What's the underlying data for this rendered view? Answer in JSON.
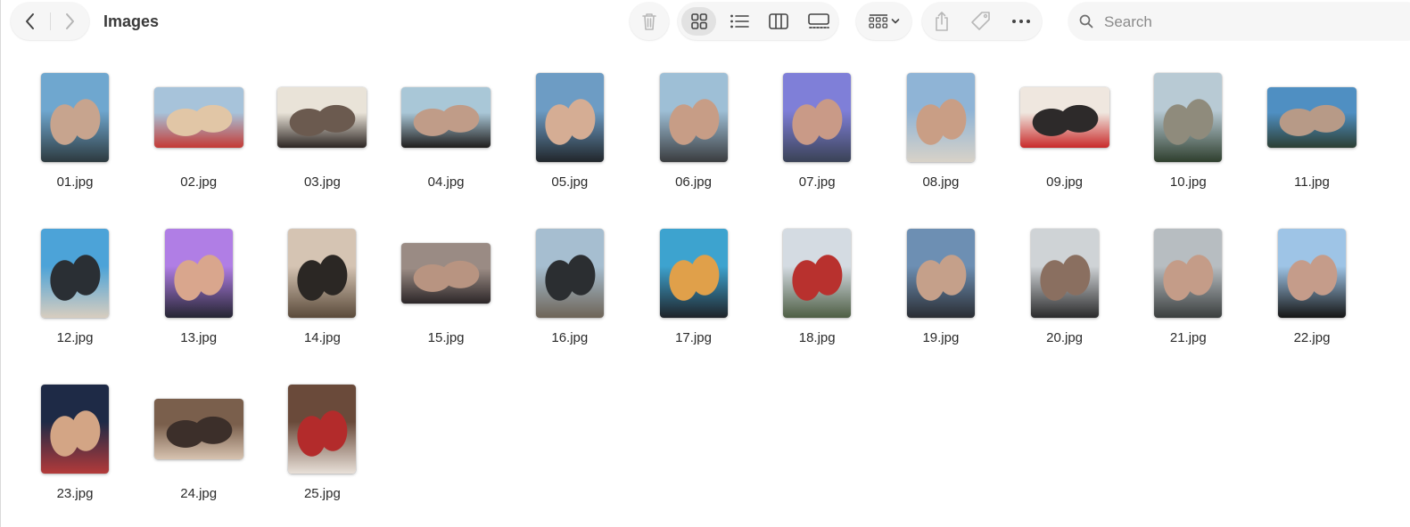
{
  "window": {
    "title": "Images",
    "nav": {
      "back": "chevron-left-icon",
      "forward": "chevron-right-icon"
    }
  },
  "toolbar": {
    "delete": "trash-icon",
    "views": [
      {
        "name": "icon-view",
        "icon": "grid-icon",
        "selected": true
      },
      {
        "name": "list-view",
        "icon": "list-icon",
        "selected": false
      },
      {
        "name": "column-view",
        "icon": "columns-icon",
        "selected": false
      },
      {
        "name": "gallery-view",
        "icon": "gallery-icon",
        "selected": false
      }
    ],
    "group_by": "group-icon",
    "share": "share-icon",
    "tags": "tag-icon",
    "more": "ellipsis-icon"
  },
  "search": {
    "placeholder": "Search"
  },
  "files": [
    {
      "name": "01.jpg",
      "orientation": "portrait",
      "colors": [
        "#6fa7cf",
        "#2d3a3f",
        "#c7a48e"
      ]
    },
    {
      "name": "02.jpg",
      "orientation": "landscape",
      "colors": [
        "#a7c3da",
        "#c43a35",
        "#e1c6a6"
      ]
    },
    {
      "name": "03.jpg",
      "orientation": "landscape",
      "colors": [
        "#e9e3d8",
        "#2c2522",
        "#6b5a4f"
      ]
    },
    {
      "name": "04.jpg",
      "orientation": "landscape",
      "colors": [
        "#a9c7d7",
        "#1f1d1c",
        "#c09c88"
      ]
    },
    {
      "name": "05.jpg",
      "orientation": "portrait",
      "colors": [
        "#6d9cc4",
        "#21262b",
        "#d5ad94"
      ]
    },
    {
      "name": "06.jpg",
      "orientation": "portrait",
      "colors": [
        "#9ebfd6",
        "#3a3c3f",
        "#c79d86"
      ]
    },
    {
      "name": "07.jpg",
      "orientation": "portrait",
      "colors": [
        "#7f7fd8",
        "#3a4256",
        "#c99a87"
      ]
    },
    {
      "name": "08.jpg",
      "orientation": "portrait",
      "colors": [
        "#8fb4d6",
        "#d8d2c8",
        "#c99e85"
      ]
    },
    {
      "name": "09.jpg",
      "orientation": "landscape",
      "colors": [
        "#efe7df",
        "#c92a2a",
        "#2d2a2a"
      ]
    },
    {
      "name": "10.jpg",
      "orientation": "portrait",
      "colors": [
        "#b8cad4",
        "#2f3f2e",
        "#8f8b7c"
      ]
    },
    {
      "name": "11.jpg",
      "orientation": "landscape",
      "colors": [
        "#4f8fc2",
        "#2c3f33",
        "#b79a87"
      ]
    },
    {
      "name": "12.jpg",
      "orientation": "portrait",
      "colors": [
        "#4ca3d8",
        "#d8cdbf",
        "#2a2f34"
      ]
    },
    {
      "name": "13.jpg",
      "orientation": "portrait",
      "colors": [
        "#b07ee5",
        "#252533",
        "#d9a68d"
      ]
    },
    {
      "name": "14.jpg",
      "orientation": "portrait",
      "colors": [
        "#d5c4b3",
        "#5a4a3a",
        "#2b2724"
      ]
    },
    {
      "name": "15.jpg",
      "orientation": "landscape",
      "colors": [
        "#9a8b84",
        "#2c2628",
        "#b89481"
      ]
    },
    {
      "name": "16.jpg",
      "orientation": "portrait",
      "colors": [
        "#a6bed0",
        "#6e6457",
        "#2b2e31"
      ]
    },
    {
      "name": "17.jpg",
      "orientation": "portrait",
      "colors": [
        "#3da3cf",
        "#1f2329",
        "#e0a04a"
      ]
    },
    {
      "name": "18.jpg",
      "orientation": "portrait",
      "colors": [
        "#d4dbe2",
        "#4e5e44",
        "#b8312e"
      ]
    },
    {
      "name": "19.jpg",
      "orientation": "portrait",
      "colors": [
        "#6d8fb3",
        "#2a2d33",
        "#c5a08a"
      ]
    },
    {
      "name": "20.jpg",
      "orientation": "portrait",
      "colors": [
        "#cfd3d6",
        "#2a2a2b",
        "#8a6f60"
      ]
    },
    {
      "name": "21.jpg",
      "orientation": "portrait",
      "colors": [
        "#b7bdc1",
        "#3a3e3e",
        "#c49c88"
      ]
    },
    {
      "name": "22.jpg",
      "orientation": "portrait",
      "colors": [
        "#9ec4e6",
        "#151515",
        "#c59c8a"
      ]
    },
    {
      "name": "23.jpg",
      "orientation": "portrait",
      "colors": [
        "#1e2a46",
        "#b33a3a",
        "#d3a585"
      ]
    },
    {
      "name": "24.jpg",
      "orientation": "landscape",
      "colors": [
        "#7a5f4c",
        "#d7c3b0",
        "#3c2f2a"
      ]
    },
    {
      "name": "25.jpg",
      "orientation": "portrait",
      "colors": [
        "#6a4a3a",
        "#e8e0d8",
        "#b32b2b"
      ]
    }
  ]
}
